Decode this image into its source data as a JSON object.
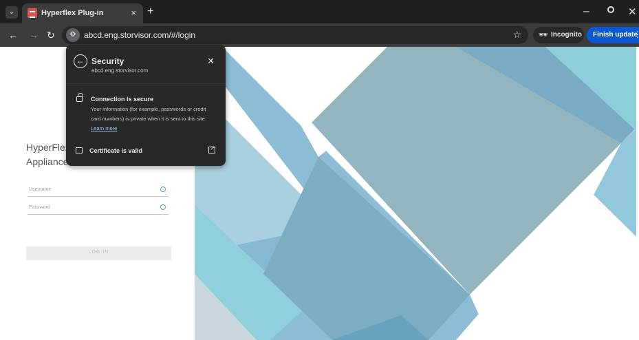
{
  "tab": {
    "title": "Hyperflex Plug-in",
    "close": "×"
  },
  "toolbar": {
    "url": "abcd.eng.storvisor.com/#/login",
    "incognito_label": "Incognito",
    "finish_update_label": "Finish update"
  },
  "popup": {
    "title": "Security",
    "domain": "abcd.eng.storvisor.com",
    "connection_title": "Connection is secure",
    "connection_desc": "Your information (for example, passwords or credit card numbers) is private when it is sent to this site.",
    "learn_more": "Learn more",
    "certificate_label": "Certificate is valid"
  },
  "login": {
    "app_title": "HyperFlex Appliance",
    "username_placeholder": "Username",
    "password_placeholder": "Password",
    "login_button": "LOG IN"
  },
  "icons": [
    "search-tabs-icon",
    "favicon",
    "close-icon",
    "plus-icon",
    "minimize-icon",
    "restore-icon",
    "back-icon",
    "forward-icon",
    "reload-icon",
    "site-info-icon",
    "star-icon",
    "incognito-icon",
    "kebab-menu-icon",
    "lock-icon",
    "certificate-icon",
    "external-link-icon",
    "info-icon",
    "eye-icon"
  ],
  "colors": {
    "accent": "#0b57d0",
    "popup_bg": "#282828",
    "chrome_dark": "#1f1f1f",
    "toolbar": "#3c3c3c"
  }
}
